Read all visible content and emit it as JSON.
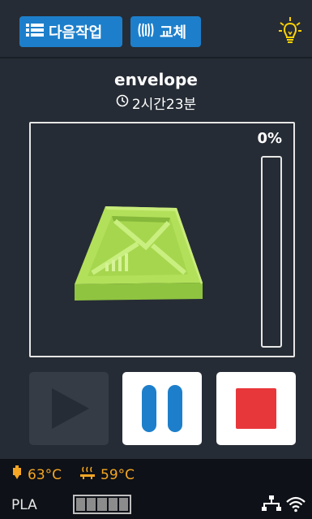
{
  "topbar": {
    "next_label": "다음작업",
    "swap_label": "교체",
    "bulb_icon": "light-bulb-icon"
  },
  "job": {
    "name": "envelope",
    "duration": "2시간23분"
  },
  "progress": {
    "label": "0%",
    "fraction": 0
  },
  "controls": {
    "play": {
      "icon": "play-icon",
      "enabled": false
    },
    "pause": {
      "icon": "pause-icon",
      "enabled": true
    },
    "stop": {
      "icon": "stop-icon",
      "enabled": true
    }
  },
  "status": {
    "nozzle_temp": "63°C",
    "bed_temp": "59°C",
    "material": "PLA",
    "filament_segments": 5
  },
  "colors": {
    "accent": "#1d7fcb",
    "model": "#b3e05a",
    "stop": "#e8373b",
    "pause": "#1d7fcb",
    "temp": "#f5a623",
    "bulb": "#ffd400"
  }
}
